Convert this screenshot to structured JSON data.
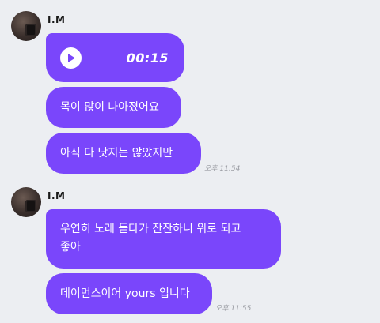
{
  "messages": [
    {
      "sender": "I.M",
      "bubbles": [
        {
          "type": "voice",
          "duration": "00:15",
          "icon": "play-icon"
        },
        {
          "type": "text",
          "text": "목이 많이 나아졌어요"
        },
        {
          "type": "text",
          "text": "아직 다 낫지는 않았지만"
        }
      ],
      "time": "오후 11:54"
    },
    {
      "sender": "I.M",
      "bubbles": [
        {
          "type": "text",
          "line1": "우연히 노래 듣다가 잔잔하니 위로 되고",
          "line2": "좋아"
        },
        {
          "type": "text",
          "text": "데이먼스이어 yours 입니다"
        }
      ],
      "time": "오후 11:55"
    }
  ],
  "colors": {
    "background": "#eceef2",
    "bubble": "#7a46fb",
    "timestamp": "#9a9ca3"
  }
}
